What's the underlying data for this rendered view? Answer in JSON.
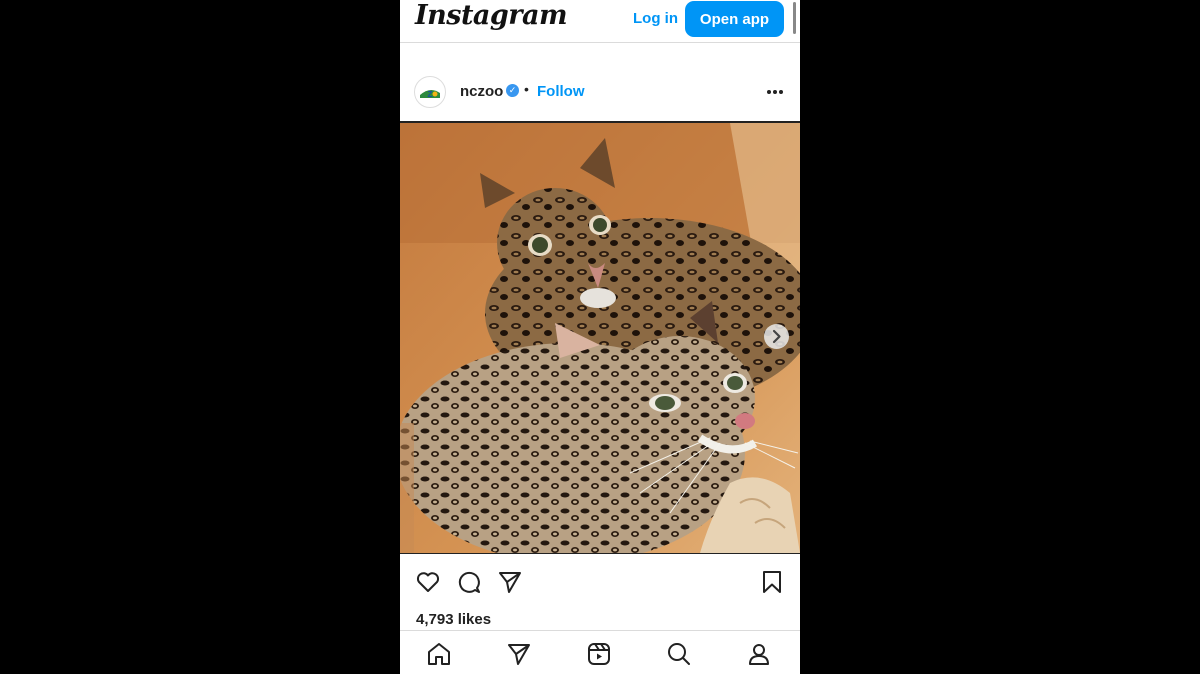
{
  "header": {
    "logo": "Instagram",
    "login_label": "Log in",
    "open_app_label": "Open app"
  },
  "post": {
    "username": "nczoo",
    "verified": true,
    "separator": "•",
    "follow_label": "Follow",
    "image_icon": "ocelots-photo",
    "likes": "4,793 likes"
  },
  "actions": [
    "heart-icon",
    "comment-icon",
    "share-icon",
    "bookmark-icon"
  ],
  "bottom_nav": [
    "home-icon",
    "direct-icon",
    "reels-icon",
    "search-icon",
    "profile-icon"
  ],
  "colors": {
    "accent": "#0095f6",
    "verified": "#3897f0",
    "background": "#000000"
  }
}
